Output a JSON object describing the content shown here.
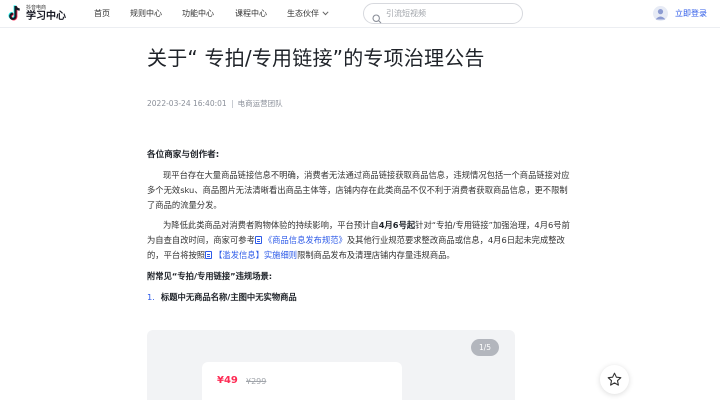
{
  "header": {
    "logo_sub": "抖音电商",
    "logo_main": "学习中心",
    "nav": [
      {
        "label": "首页"
      },
      {
        "label": "规则中心"
      },
      {
        "label": "功能中心"
      },
      {
        "label": "课程中心"
      },
      {
        "label": "生态伙伴"
      }
    ],
    "search_placeholder": "引流短视频",
    "login_label": "立即登录"
  },
  "article": {
    "title": "关于“ 专拍/专用链接”的专项治理公告",
    "date": "2022-03-24 16:40:01",
    "author": "电商运营团队",
    "greeting": "各位商家与创作者:",
    "p1": "现平台存在大量商品链接信息不明确，消费者无法通过商品链接获取商品信息，违规情况包括一个商品链接对应多个无效sku、商品图片无法清晰看出商品主体等，店铺内存在此类商品不仅不利于消费者获取商品信息，更不限制了商品的流量分发。",
    "p2_a": "为降低此类商品对消费者购物体验的持续影响，平台预计自",
    "p2_bold": "4月6号起",
    "p2_b": "针对“专拍/专用链接”加强治理，4月6号前为自查自改时间，商家可参考",
    "p2_link1": "《商品信息发布规范》",
    "p2_c": "及其他行业规范要求整改商品或信息，4月6日起未完成整改的，平台将按照",
    "p2_link2": "【滥发信息】实施细则",
    "p2_d": "限制商品发布及清理店铺内存量违规商品。",
    "subhead": "附常见“专拍/专用链接”违规场景:",
    "list": [
      {
        "num": "1.",
        "text": "标题中无商品名称/主图中无实物商品"
      }
    ]
  },
  "gallery": {
    "counter": "1/5",
    "price": "¥49",
    "price_old": "¥299"
  },
  "colors": {
    "accent": "#2c5ae8",
    "price": "#fe2c55"
  },
  "icons": [
    "douyin-logo-icon",
    "search-icon",
    "chevron-down-icon",
    "user-icon",
    "doc-icon",
    "star-icon"
  ]
}
